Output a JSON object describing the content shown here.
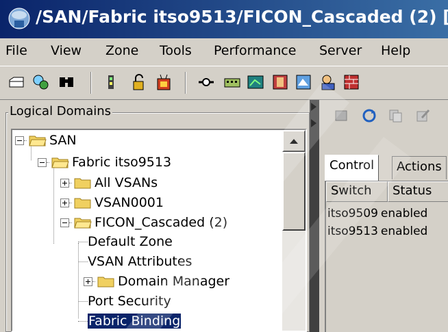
{
  "window": {
    "title": "/SAN/Fabric itso9513/FICON_Cascaded (2) [e"
  },
  "menubar": {
    "items": [
      "File",
      "View",
      "Zone",
      "Tools",
      "Performance",
      "Server",
      "Help"
    ]
  },
  "toolbar": {
    "icons": [
      "open-icon",
      "discover-icon",
      "find-icon",
      "properties-icon",
      "lock-icon",
      "events-icon",
      "link-icon",
      "switch-icon",
      "topology-icon",
      "device-icon",
      "monitor-icon",
      "user-icon",
      "firewall-icon"
    ]
  },
  "left": {
    "group_label": "Logical Domains",
    "tree": [
      {
        "label": "SAN",
        "expander": "minus",
        "icon": "folder-open-icon"
      },
      {
        "label": "Fabric itso9513",
        "expander": "minus",
        "icon": "folder-open-icon"
      },
      {
        "label": "All VSANs",
        "expander": "plus",
        "icon": "folder-icon"
      },
      {
        "label": "VSAN0001",
        "expander": "plus",
        "icon": "folder-icon"
      },
      {
        "label": "FICON_Cascaded (2)",
        "expander": "minus",
        "icon": "folder-open-icon"
      },
      {
        "label": "Default Zone"
      },
      {
        "label": "VSAN Attributes"
      },
      {
        "label": "Domain Manager",
        "expander": "plus",
        "icon": "folder-icon"
      },
      {
        "label": "Port Security"
      },
      {
        "label": "Fabric Binding",
        "selected": true
      }
    ]
  },
  "right": {
    "tabs": [
      "Control",
      "Actions"
    ],
    "columns": [
      "Switch",
      "Status"
    ],
    "rows": [
      [
        "itso9509",
        "enabled"
      ],
      [
        "itso9513",
        "enabled"
      ]
    ]
  },
  "colors": {
    "title_bg": "#0a246a",
    "selection": "#0a246a",
    "folder": "#f0d060"
  }
}
